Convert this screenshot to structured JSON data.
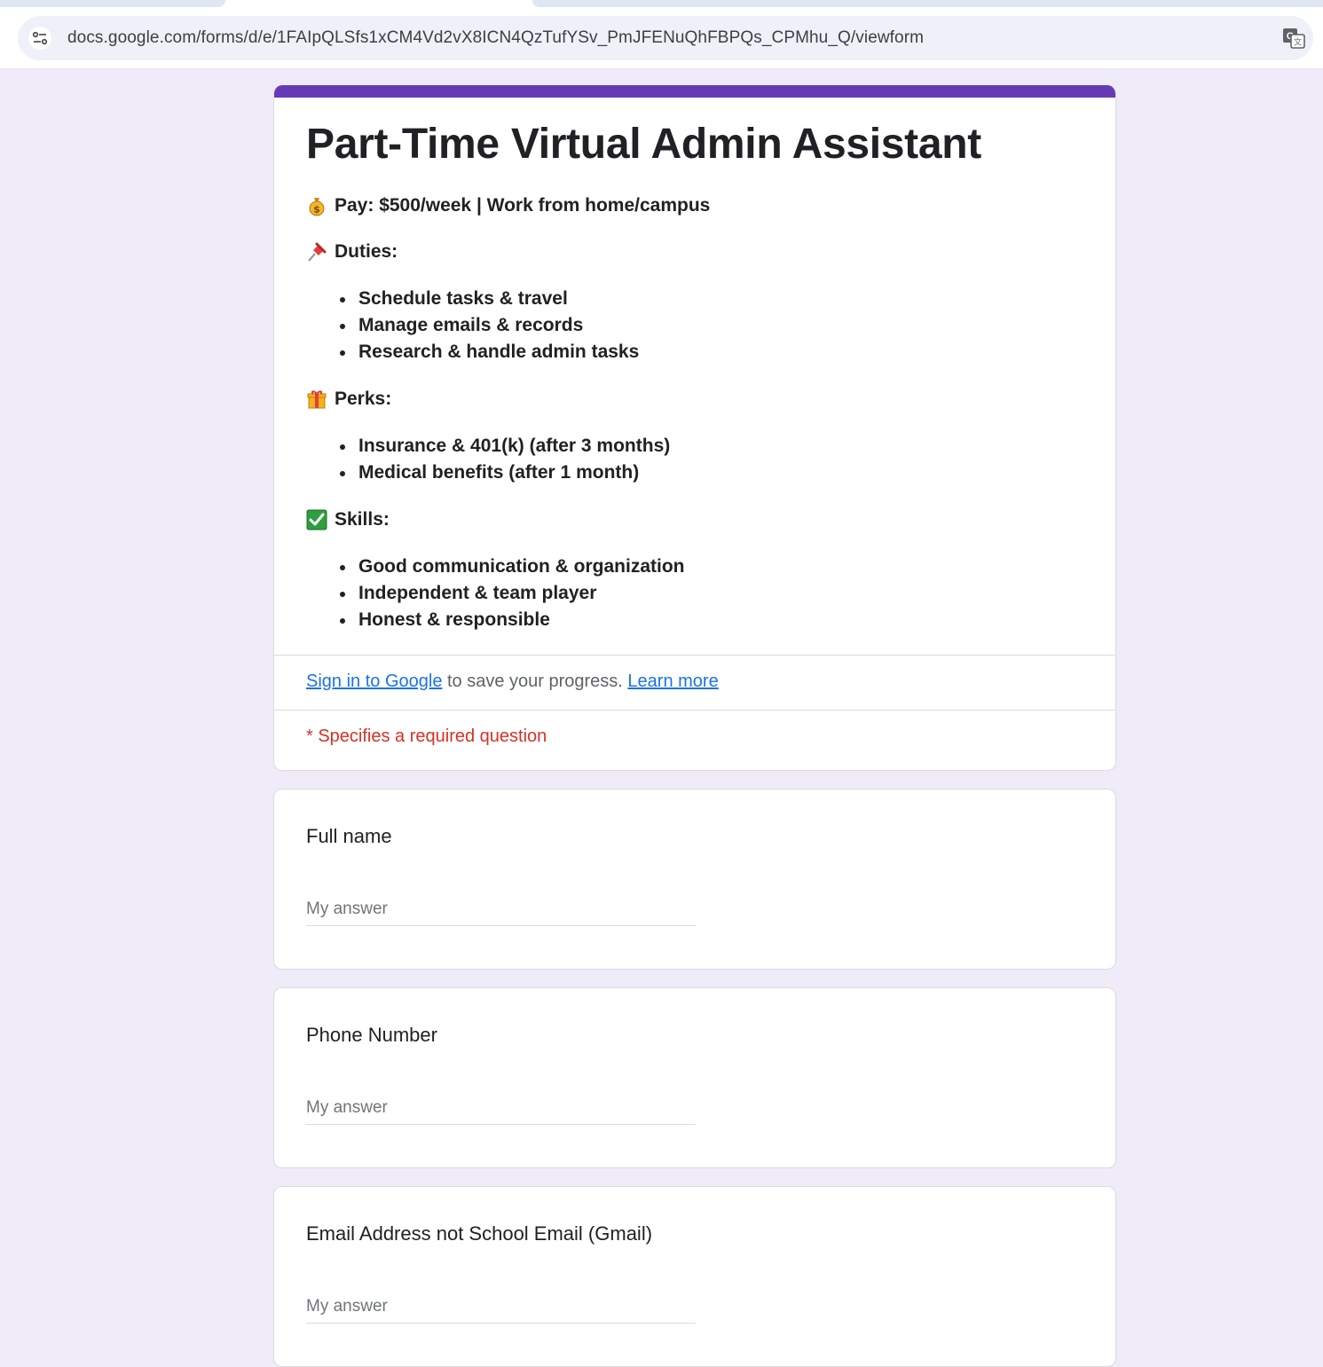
{
  "browser": {
    "url": "docs.google.com/forms/d/e/1FAIpQLSfs1xCM4Vd2vX8ICN4QzTufYSv_PmJFENuQhFBPQs_CPMhu_Q/viewform"
  },
  "form": {
    "accent_color": "#673ab7",
    "title": "Part-Time Virtual Admin Assistant",
    "pay_line": "Pay: $500/week | Work from home/campus",
    "duties_heading": "Duties:",
    "duties": [
      "Schedule tasks & travel",
      "Manage emails & records",
      "Research & handle admin tasks"
    ],
    "perks_heading": "Perks:",
    "perks": [
      "Insurance & 401(k) (after 3 months)",
      "Medical benefits (after 1 month)"
    ],
    "skills_heading": "Skills:",
    "skills": [
      "Good communication & organization",
      "Independent & team player",
      "Honest & responsible"
    ],
    "signin": {
      "link_label": "Sign in to Google",
      "text": " to save your progress. ",
      "learn_more": "Learn more"
    },
    "required_note": "* Specifies a required question",
    "questions": [
      {
        "title": "Full name",
        "placeholder": "My answer"
      },
      {
        "title": "Phone Number",
        "placeholder": "My answer"
      },
      {
        "title": "Email Address not School Email (Gmail)",
        "placeholder": "My answer"
      }
    ]
  },
  "icons": {
    "pay": "money-bag-icon",
    "duties": "pushpin-icon",
    "perks": "gift-icon",
    "skills": "checkmark-box-icon",
    "site_info": "tune-icon",
    "translate": "translate-icon"
  }
}
